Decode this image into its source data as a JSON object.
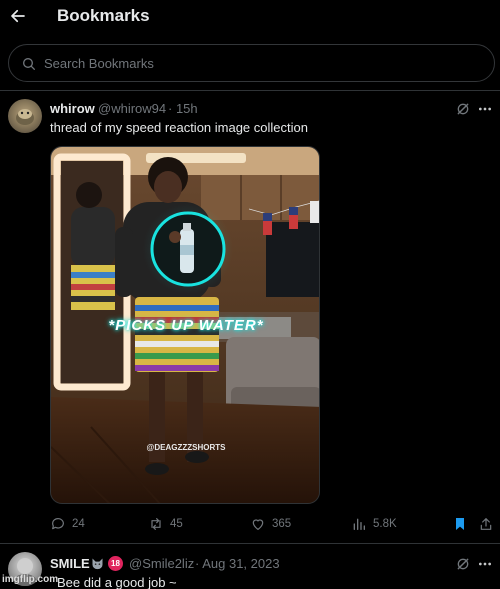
{
  "header": {
    "title": "Bookmarks"
  },
  "search": {
    "placeholder": "Search Bookmarks"
  },
  "tweet1": {
    "name": "whirow",
    "handle": "@whirow94",
    "time": "· 15h",
    "text": "thread of my speed reaction image collection",
    "media": {
      "caption": "*PICKS UP WATER*",
      "watermark": "@DEAGZZZSHORTS"
    },
    "stats": {
      "replies": "24",
      "reposts": "45",
      "likes": "365",
      "views": "5.8K"
    },
    "colors": {
      "bookmark_active": "#1d9bf0",
      "ring": "#19e3e0"
    }
  },
  "tweet2": {
    "name": "SMILE",
    "badge": "18",
    "handle": "@Smile2liz",
    "time": "· Aug 31, 2023",
    "text": "Bee did a good job ~"
  },
  "overlay": {
    "watermark": "imgflip.com"
  },
  "icons": [
    "back-arrow-icon",
    "search-icon",
    "grok-icon",
    "more-icon",
    "reply-icon",
    "repost-icon",
    "like-icon",
    "views-icon",
    "bookmark-icon",
    "share-icon"
  ]
}
